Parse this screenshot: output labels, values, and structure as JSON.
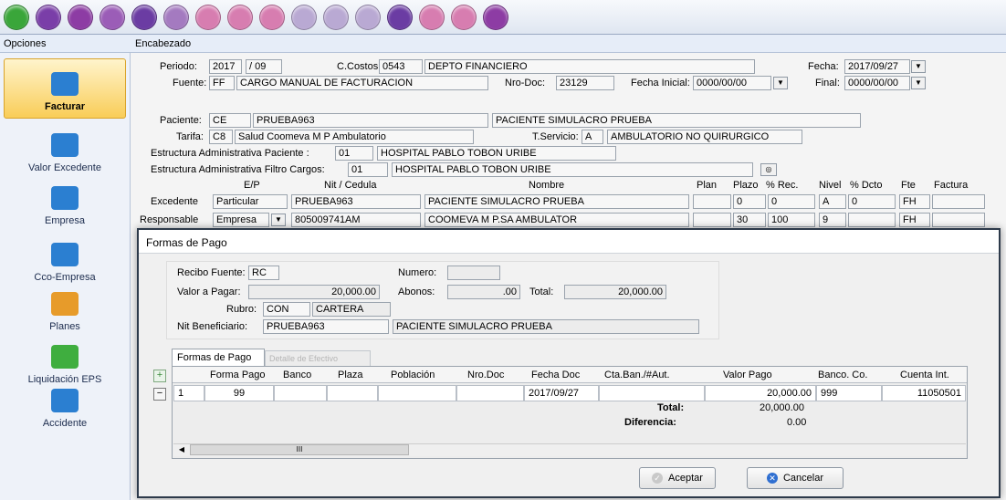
{
  "toolbar": {
    "buttons": [
      {
        "name": "enter-icon",
        "color": "#3aa63a"
      },
      {
        "name": "delete-icon",
        "color": "#7a3ea8"
      },
      {
        "name": "save-icon",
        "color": "#8d3ca4"
      },
      {
        "name": "cancel-icon",
        "color": "#9b5db7"
      },
      {
        "name": "search-icon",
        "color": "#6b3ca3"
      },
      {
        "name": "refresh-icon",
        "color": "#a47ac0"
      },
      {
        "name": "view-icon",
        "color": "#d77db0"
      },
      {
        "name": "print-icon",
        "color": "#d77db0"
      },
      {
        "name": "print-preview-icon",
        "color": "#d77db0"
      },
      {
        "name": "edit-icon",
        "color": "#b9a9d3"
      },
      {
        "name": "list-icon",
        "color": "#b9a9d3"
      },
      {
        "name": "globe-icon",
        "color": "#b9a9d3"
      },
      {
        "name": "add-icon",
        "color": "#6b3ca3"
      },
      {
        "name": "first-icon",
        "color": "#d77db0"
      },
      {
        "name": "prev-icon",
        "color": "#d77db0"
      },
      {
        "name": "exit-icon",
        "color": "#8d3ca4"
      }
    ]
  },
  "header": {
    "opciones": "Opciones",
    "encabezado": "Encabezado"
  },
  "sidebar": {
    "items": [
      {
        "label": "Facturar",
        "name": "sidebar-item-facturar",
        "icon": "invoice-icon",
        "color": "#2b7fd1",
        "active": true
      },
      {
        "label": "Valor Excedente",
        "name": "sidebar-item-valor-excedente",
        "icon": "calculator-icon",
        "color": "#2b7fd1"
      },
      {
        "label": "Empresa",
        "name": "sidebar-item-empresa",
        "icon": "company-icon",
        "color": "#2b7fd1"
      },
      {
        "label": "Cco-Empresa",
        "name": "sidebar-item-cco-empresa",
        "icon": "network-icon",
        "color": "#2b7fd1"
      },
      {
        "label": "Planes",
        "name": "sidebar-item-planes",
        "icon": "plans-icon",
        "color": "#e79b2a"
      },
      {
        "label": "Liquidación EPS",
        "name": "sidebar-item-liquidacion-eps",
        "icon": "eps-icon",
        "color": "#3fae3f"
      },
      {
        "label": "Accidente",
        "name": "sidebar-item-accidente",
        "icon": "ambulance-icon",
        "color": "#2b7fd1"
      }
    ]
  },
  "form": {
    "periodo_label": "Periodo:",
    "periodo_year": "2017",
    "periodo_sep": "/",
    "periodo_month": "09",
    "ccostos_label": "C.Costos",
    "ccostos_code": "0543",
    "ccostos_name": "DEPTO FINANCIERO",
    "fecha_label": "Fecha:",
    "fecha_value": "2017/09/27",
    "fuente_label": "Fuente:",
    "fuente_code": "FF",
    "fuente_name": "CARGO MANUAL DE FACTURACION",
    "nrodoc_label": "Nro-Doc:",
    "nrodoc_value": "23129",
    "fecha_inicial_label": "Fecha Inicial:",
    "fecha_inicial_value": "0000/00/00",
    "final_label": "Final:",
    "final_value": "0000/00/00",
    "paciente_label": "Paciente:",
    "paciente_type": "CE",
    "paciente_id": "PRUEBA963",
    "paciente_name": "PACIENTE SIMULACRO PRUEBA",
    "tarifa_label": "Tarifa:",
    "tarifa_code": "C8",
    "tarifa_name": "Salud Coomeva M P Ambulatorio",
    "tservicio_label": "T.Servicio:",
    "tservicio_code": "A",
    "tservicio_name": "AMBULATORIO NO QUIRURGICO",
    "estructura_paciente_label": "Estructura Administrativa Paciente :",
    "estructura_paciente_code": "01",
    "estructura_paciente_name": "HOSPITAL PABLO TOBON URIBE",
    "estructura_filtro_label": "Estructura Administrativa Filtro Cargos:",
    "estructura_filtro_code": "01",
    "estructura_filtro_name": "HOSPITAL PABLO TOBON URIBE",
    "cols": {
      "ep": "E/P",
      "nit": "Nit / Cedula",
      "nombre": "Nombre",
      "plan": "Plan",
      "plazo": "Plazo",
      "rec": "% Rec.",
      "nivel": "Nivel",
      "dcto": "% Dcto",
      "fte": "Fte",
      "factura": "Factura"
    },
    "excedente": {
      "label": "Excedente",
      "ep": "Particular",
      "nit": "PRUEBA963",
      "nombre": "PACIENTE SIMULACRO PRUEBA",
      "plan": "",
      "plazo": "0",
      "rec": "0",
      "nivel": "A",
      "dcto": "0",
      "fte": "FH",
      "factura": ""
    },
    "responsable": {
      "label": "Responsable",
      "ep": "Empresa",
      "nit": "805009741AM",
      "nombre": "COOMEVA M P.SA AMBULATOR",
      "plan": "",
      "plazo": "30",
      "rec": "100",
      "nivel": "9",
      "dcto": "",
      "fte": "FH",
      "factura": ""
    }
  },
  "dialog": {
    "title": "Formas de Pago",
    "recibo_label": "Recibo Fuente:",
    "recibo_value": "RC",
    "numero_label": "Numero:",
    "numero_value": "",
    "valor_label": "Valor a Pagar:",
    "valor_value": "20,000.00",
    "abonos_label": "Abonos:",
    "abonos_value": ".00",
    "total_label": "Total:",
    "total_value": "20,000.00",
    "rubro_label": "Rubro:",
    "rubro_code": "CON",
    "rubro_name": "CARTERA",
    "nit_label": "Nit Beneficiario:",
    "nit_value": "PRUEBA963",
    "nit_name": "PACIENTE SIMULACRO PRUEBA",
    "tabs": [
      {
        "label": "Formas de Pago"
      },
      {
        "label": "Detalle de Efectivo"
      }
    ],
    "grid": {
      "columns": [
        "Forma Pago",
        "Banco",
        "Plaza",
        "Población",
        "Nro.Doc",
        "Fecha Doc",
        "Cta.Ban./#Aut.",
        "Valor Pago",
        "Banco. Co.",
        "Cuenta Int."
      ],
      "rows": [
        {
          "num": "1",
          "forma_pago": "99",
          "banco": "",
          "plaza": "",
          "poblacion": "",
          "nro_doc": "",
          "fecha_doc": "2017/09/27",
          "cta": "",
          "valor_pago": "20,000.00",
          "banco_co": "999",
          "cuenta_int": "11050501"
        }
      ],
      "total_label": "Total:",
      "total_value": "20,000.00",
      "diferencia_label": "Diferencia:",
      "diferencia_value": "0.00"
    },
    "scroll_thumb": "III",
    "accept_label": "Aceptar",
    "cancel_label": "Cancelar"
  }
}
